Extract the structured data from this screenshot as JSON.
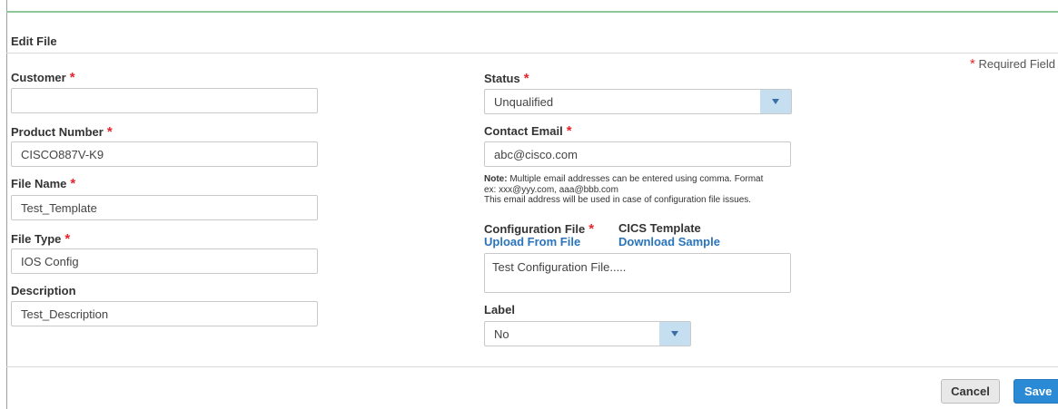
{
  "panel": {
    "title": "Edit File"
  },
  "required_note": {
    "star": "*",
    "text": "Required Field"
  },
  "form": {
    "customer": {
      "label": "Customer",
      "star": "*",
      "value": ""
    },
    "product_number": {
      "label": "Product Number",
      "star": "*",
      "value": "CISCO887V-K9"
    },
    "file_name": {
      "label": "File Name",
      "star": "*",
      "value": "Test_Template"
    },
    "file_type": {
      "label": "File Type",
      "star": "*",
      "value": "IOS Config"
    },
    "description": {
      "label": "Description",
      "value": "Test_Description"
    },
    "status": {
      "label": "Status",
      "star": "*",
      "value": "Unqualified"
    },
    "contact_email": {
      "label": "Contact Email",
      "star": "*",
      "value": "abc@cisco.com"
    },
    "note": {
      "bold": "Note:",
      "line1": " Multiple email addresses can be entered using comma. Format",
      "line2": "ex: xxx@yyy.com, aaa@bbb.com",
      "line3": "This email address will be used in case of configuration file issues."
    },
    "configuration_file": {
      "label": "Configuration File",
      "star": "*",
      "upload_link": "Upload From File",
      "value": "Test Configuration File....."
    },
    "cics_template": {
      "label": "CICS Template",
      "download_link": "Download Sample"
    },
    "label_field": {
      "label": "Label",
      "value": "No"
    }
  },
  "buttons": {
    "cancel": "Cancel",
    "save": "Save"
  },
  "colors": {
    "accent_line": "#8fc79a",
    "required_star": "#e8242c",
    "link": "#2a74b9",
    "primary_button": "#2a8ad6"
  }
}
